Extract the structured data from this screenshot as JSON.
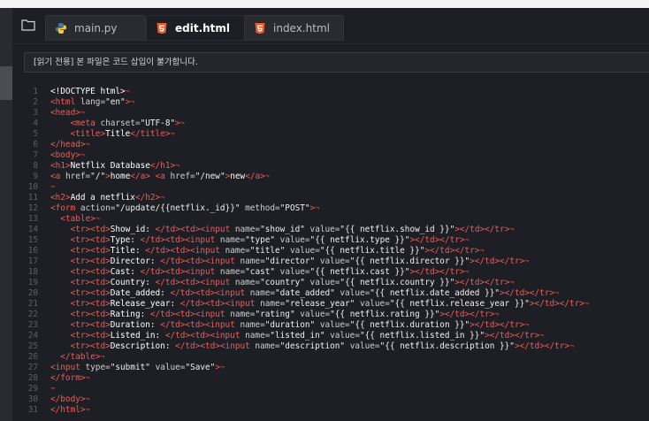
{
  "tabs": [
    {
      "label": "main.py",
      "icon": "python-icon"
    },
    {
      "label": "edit.html",
      "icon": "html5-icon",
      "active": true,
      "close": "×"
    },
    {
      "label": "index.html",
      "icon": "html5-icon"
    }
  ],
  "banner": {
    "text": "[읽기 전용] 본 파일은 코드 삽입이 불가합니다."
  },
  "editor": {
    "eol_marker": "¬",
    "lines": [
      [
        [
          "tx",
          "<!DOCTYPE html>"
        ]
      ],
      [
        [
          "tg",
          "<html "
        ],
        [
          "at",
          "lang="
        ],
        [
          "st",
          "\"en\""
        ],
        [
          "tg",
          ">"
        ]
      ],
      [
        [
          "tg",
          "<head>"
        ]
      ],
      [
        [
          "tx",
          "    "
        ],
        [
          "tg",
          "<meta "
        ],
        [
          "at",
          "charset="
        ],
        [
          "st",
          "\"UTF-8\""
        ],
        [
          "tg",
          ">"
        ]
      ],
      [
        [
          "tx",
          "    "
        ],
        [
          "tg",
          "<title>"
        ],
        [
          "tx",
          "Title"
        ],
        [
          "tg",
          "</title>"
        ]
      ],
      [
        [
          "tg",
          "</head>"
        ]
      ],
      [
        [
          "tg",
          "<body>"
        ]
      ],
      [
        [
          "tg",
          "<h1>"
        ],
        [
          "tx",
          "Netflix Database"
        ],
        [
          "tg",
          "</h1>"
        ]
      ],
      [
        [
          "tg",
          "<a "
        ],
        [
          "at",
          "href="
        ],
        [
          "st",
          "\"/\""
        ],
        [
          "tg",
          ">"
        ],
        [
          "tx",
          "home"
        ],
        [
          "tg",
          "</a> <a "
        ],
        [
          "at",
          "href="
        ],
        [
          "st",
          "\"/new\""
        ],
        [
          "tg",
          ">"
        ],
        [
          "tx",
          "new"
        ],
        [
          "tg",
          "</a>"
        ]
      ],
      [],
      [
        [
          "tg",
          "<h2>"
        ],
        [
          "tx",
          "Add a netflix"
        ],
        [
          "tg",
          "</h2>"
        ]
      ],
      [
        [
          "tg",
          "<form "
        ],
        [
          "at",
          "action="
        ],
        [
          "st",
          "\"/update/{{netflix._id}}\" "
        ],
        [
          "at",
          "method="
        ],
        [
          "st",
          "\"POST\""
        ],
        [
          "tg",
          ">"
        ]
      ],
      [
        [
          "tx",
          "  "
        ],
        [
          "tg",
          "<table>"
        ]
      ],
      [
        [
          "tx",
          "    "
        ],
        [
          "tg",
          "<tr><td>"
        ],
        [
          "tx",
          "Show_id: "
        ],
        [
          "tg",
          "</td><td><input "
        ],
        [
          "at",
          "name="
        ],
        [
          "st",
          "\"show_id\" "
        ],
        [
          "at",
          "value="
        ],
        [
          "st",
          "\"{{ netflix.show_id }}\""
        ],
        [
          "tg",
          "></td></tr>"
        ]
      ],
      [
        [
          "tx",
          "    "
        ],
        [
          "tg",
          "<tr><td>"
        ],
        [
          "tx",
          "Type: "
        ],
        [
          "tg",
          "</td><td><input "
        ],
        [
          "at",
          "name="
        ],
        [
          "st",
          "\"type\" "
        ],
        [
          "at",
          "value="
        ],
        [
          "st",
          "\"{{ netflix.type }}\""
        ],
        [
          "tg",
          "></td></tr>"
        ]
      ],
      [
        [
          "tx",
          "    "
        ],
        [
          "tg",
          "<tr><td>"
        ],
        [
          "tx",
          "Title: "
        ],
        [
          "tg",
          "</td><td><input "
        ],
        [
          "at",
          "name="
        ],
        [
          "st",
          "\"title\" "
        ],
        [
          "at",
          "value="
        ],
        [
          "st",
          "\"{{ netflix.title }}\""
        ],
        [
          "tg",
          "></td></tr>"
        ]
      ],
      [
        [
          "tx",
          "    "
        ],
        [
          "tg",
          "<tr><td>"
        ],
        [
          "tx",
          "Director: "
        ],
        [
          "tg",
          "</td><td><input "
        ],
        [
          "at",
          "name="
        ],
        [
          "st",
          "\"director\" "
        ],
        [
          "at",
          "value="
        ],
        [
          "st",
          "\"{{ netflix.director }}\""
        ],
        [
          "tg",
          "></td></tr>"
        ]
      ],
      [
        [
          "tx",
          "    "
        ],
        [
          "tg",
          "<tr><td>"
        ],
        [
          "tx",
          "Cast: "
        ],
        [
          "tg",
          "</td><td><input "
        ],
        [
          "at",
          "name="
        ],
        [
          "st",
          "\"cast\" "
        ],
        [
          "at",
          "value="
        ],
        [
          "st",
          "\"{{ netflix.cast }}\""
        ],
        [
          "tg",
          "></td></tr>"
        ]
      ],
      [
        [
          "tx",
          "    "
        ],
        [
          "tg",
          "<tr><td>"
        ],
        [
          "tx",
          "Country: "
        ],
        [
          "tg",
          "</td><td><input "
        ],
        [
          "at",
          "name="
        ],
        [
          "st",
          "\"country\" "
        ],
        [
          "at",
          "value="
        ],
        [
          "st",
          "\"{{ netflix.country }}\""
        ],
        [
          "tg",
          "></td></tr>"
        ]
      ],
      [
        [
          "tx",
          "    "
        ],
        [
          "tg",
          "<tr><td>"
        ],
        [
          "tx",
          "Date_added: "
        ],
        [
          "tg",
          "</td><td><input "
        ],
        [
          "at",
          "name="
        ],
        [
          "st",
          "\"date_added\" "
        ],
        [
          "at",
          "value="
        ],
        [
          "st",
          "\"{{ netflix.date_added }}\""
        ],
        [
          "tg",
          "></td></tr>"
        ]
      ],
      [
        [
          "tx",
          "    "
        ],
        [
          "tg",
          "<tr><td>"
        ],
        [
          "tx",
          "Release_year: "
        ],
        [
          "tg",
          "</td><td><input "
        ],
        [
          "at",
          "name="
        ],
        [
          "st",
          "\"release_year\" "
        ],
        [
          "at",
          "value="
        ],
        [
          "st",
          "\"{{ netflix.release_year }}\""
        ],
        [
          "tg",
          "></td></tr>"
        ]
      ],
      [
        [
          "tx",
          "    "
        ],
        [
          "tg",
          "<tr><td>"
        ],
        [
          "tx",
          "Rating: "
        ],
        [
          "tg",
          "</td><td><input "
        ],
        [
          "at",
          "name="
        ],
        [
          "st",
          "\"rating\" "
        ],
        [
          "at",
          "value="
        ],
        [
          "st",
          "\"{{ netflix.rating }}\""
        ],
        [
          "tg",
          "></td></tr>"
        ]
      ],
      [
        [
          "tx",
          "    "
        ],
        [
          "tg",
          "<tr><td>"
        ],
        [
          "tx",
          "Duration: "
        ],
        [
          "tg",
          "</td><td><input "
        ],
        [
          "at",
          "name="
        ],
        [
          "st",
          "\"duration\" "
        ],
        [
          "at",
          "value="
        ],
        [
          "st",
          "\"{{ netflix.duration }}\""
        ],
        [
          "tg",
          "></td></tr>"
        ]
      ],
      [
        [
          "tx",
          "    "
        ],
        [
          "tg",
          "<tr><td>"
        ],
        [
          "tx",
          "Listed_in: "
        ],
        [
          "tg",
          "</td><td><input "
        ],
        [
          "at",
          "name="
        ],
        [
          "st",
          "\"listed_in\" "
        ],
        [
          "at",
          "value="
        ],
        [
          "st",
          "\"{{ netflix.listed_in }}\""
        ],
        [
          "tg",
          "></td></tr>"
        ]
      ],
      [
        [
          "tx",
          "    "
        ],
        [
          "tg",
          "<tr><td>"
        ],
        [
          "tx",
          "Description: "
        ],
        [
          "tg",
          "</td><td><input "
        ],
        [
          "at",
          "name="
        ],
        [
          "st",
          "\"description\" "
        ],
        [
          "at",
          "value="
        ],
        [
          "st",
          "\"{{ netflix.description }}\""
        ],
        [
          "tg",
          "></td></tr>"
        ]
      ],
      [
        [
          "tx",
          "  "
        ],
        [
          "tg",
          "</table>"
        ]
      ],
      [
        [
          "tg",
          "<input "
        ],
        [
          "at",
          "type="
        ],
        [
          "st",
          "\"submit\" "
        ],
        [
          "at",
          "value="
        ],
        [
          "st",
          "\"Save\""
        ],
        [
          "tg",
          ">"
        ]
      ],
      [
        [
          "tg",
          "</form>"
        ]
      ],
      [],
      [
        [
          "tg",
          "</body>"
        ]
      ],
      [
        [
          "tg",
          "</html>"
        ]
      ]
    ]
  }
}
